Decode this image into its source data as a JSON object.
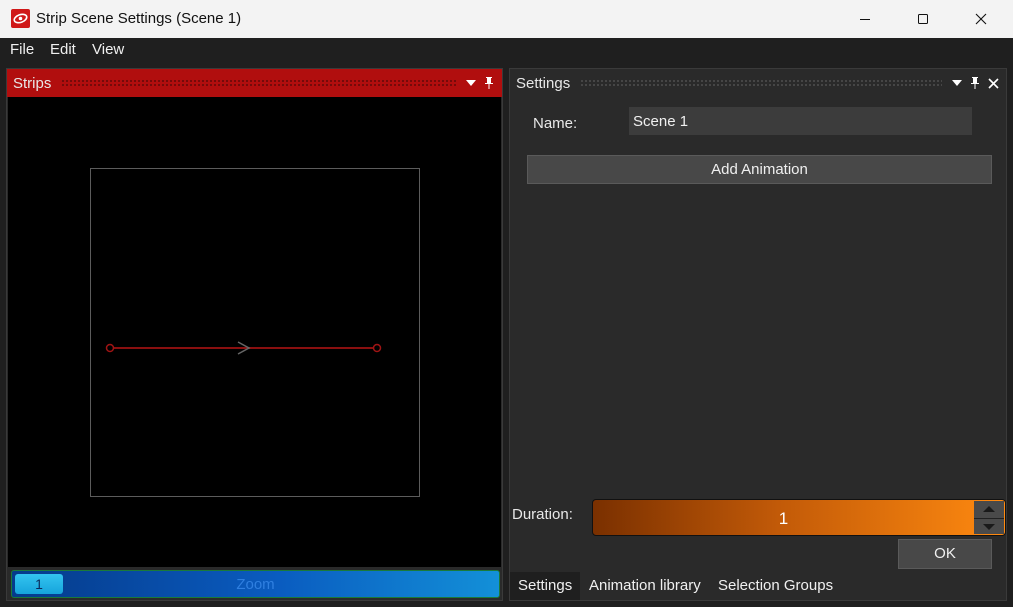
{
  "window": {
    "title": "Strip Scene Settings (Scene 1)"
  },
  "menu": {
    "items": [
      "File",
      "Edit",
      "View"
    ]
  },
  "strips_panel": {
    "title": "Strips",
    "zoom": {
      "value": "1",
      "label": "Zoom"
    }
  },
  "settings_panel": {
    "title": "Settings",
    "name_label": "Name:",
    "name_value": "Scene 1",
    "add_animation_label": "Add Animation",
    "duration_label": "Duration:",
    "duration_value": "1",
    "ok_label": "OK",
    "tabs": [
      "Settings",
      "Animation library",
      "Selection Groups"
    ],
    "active_tab": "Settings"
  },
  "colors": {
    "strips_header": "#b10e0e",
    "strip_line": "#8a0f0f",
    "zoom_bar": "#0a5cc0",
    "duration_gradient_end": "#ff8a10"
  },
  "icons": {
    "app": "app-logo-icon",
    "dock_menu": "triangle-down-icon",
    "dock_pin": "pin-icon",
    "dock_close": "close-icon"
  }
}
